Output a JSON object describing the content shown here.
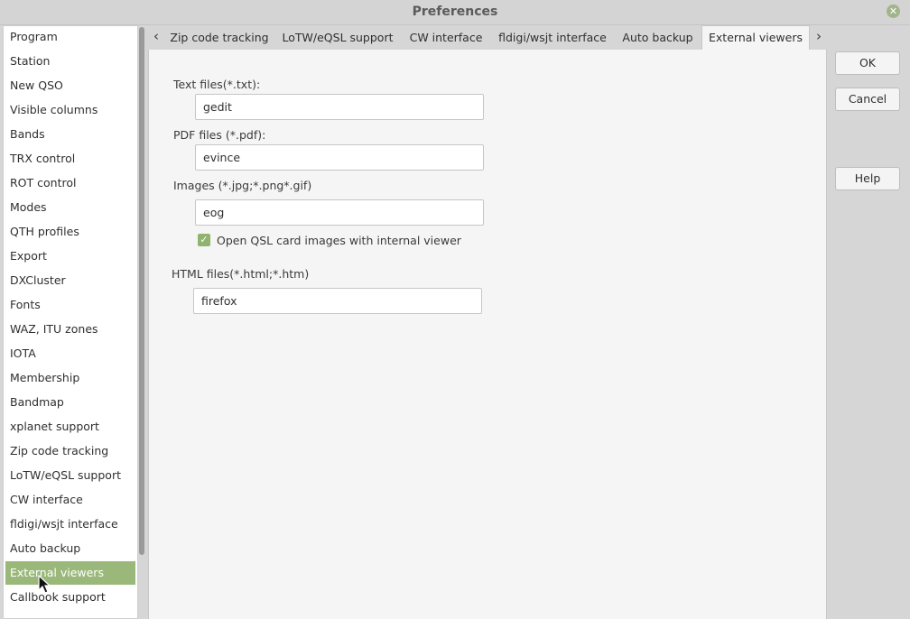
{
  "window": {
    "title": "Preferences",
    "close_icon": "close-icon"
  },
  "sidebar": {
    "items": [
      {
        "label": "Program"
      },
      {
        "label": "Station"
      },
      {
        "label": "New QSO"
      },
      {
        "label": "Visible columns"
      },
      {
        "label": "Bands"
      },
      {
        "label": "TRX control"
      },
      {
        "label": "ROT control"
      },
      {
        "label": "Modes"
      },
      {
        "label": "QTH profiles"
      },
      {
        "label": "Export"
      },
      {
        "label": "DXCluster"
      },
      {
        "label": "Fonts"
      },
      {
        "label": "WAZ, ITU zones"
      },
      {
        "label": "IOTA"
      },
      {
        "label": "Membership"
      },
      {
        "label": "Bandmap"
      },
      {
        "label": "xplanet support"
      },
      {
        "label": "Zip code tracking"
      },
      {
        "label": "LoTW/eQSL support"
      },
      {
        "label": "CW interface"
      },
      {
        "label": "fldigi/wsjt interface"
      },
      {
        "label": "Auto backup"
      },
      {
        "label": "External viewers",
        "selected": true
      },
      {
        "label": "Callbook support"
      }
    ]
  },
  "tabs": {
    "items": [
      {
        "label": "Zip code tracking"
      },
      {
        "label": "LoTW/eQSL support"
      },
      {
        "label": "CW interface"
      },
      {
        "label": "fldigi/wsjt interface"
      },
      {
        "label": "Auto backup"
      },
      {
        "label": "External viewers",
        "active": true
      }
    ],
    "prev_icon": "‹",
    "next_icon": "›"
  },
  "main": {
    "text_files": {
      "label": "Text files(*.txt):",
      "value": "gedit"
    },
    "pdf_files": {
      "label": "PDF files (*.pdf):",
      "value": "evince"
    },
    "images": {
      "label": "Images (*.jpg;*.png*.gif)",
      "value": "eog"
    },
    "qsl_checkbox": {
      "label": "Open QSL card images with internal viewer",
      "checked": true
    },
    "html_files": {
      "label": "HTML files(*.html;*.htm)",
      "value": "firefox"
    }
  },
  "buttons": {
    "ok": "OK",
    "cancel": "Cancel",
    "help": "Help"
  },
  "colors": {
    "accent": "#9ab87a",
    "checkbox": "#8fb46f",
    "window_bg": "#d6d6d6",
    "panel_bg": "#f5f5f5"
  }
}
